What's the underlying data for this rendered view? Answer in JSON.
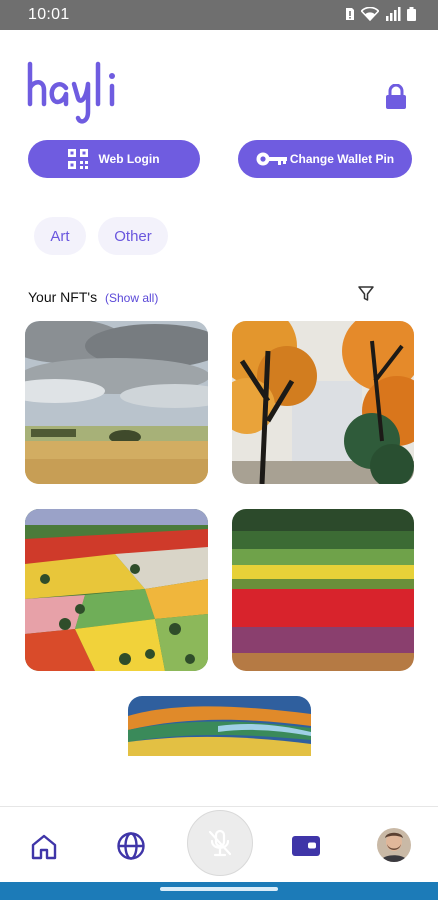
{
  "status_bar": {
    "time": "10:01"
  },
  "app": {
    "logo_text": "hayli",
    "brand_color": "#6f5ce0"
  },
  "actions": {
    "web_login_label": "Web Login",
    "change_pin_label": "Change Wallet Pin"
  },
  "categories": [
    "Art",
    "Other"
  ],
  "nfts_section": {
    "title": "Your NFT's",
    "show_all": "(Show all)"
  },
  "nfts": [
    {
      "name": "nft-clouds-field"
    },
    {
      "name": "nft-autumn-trees"
    },
    {
      "name": "nft-patchwork-fields"
    },
    {
      "name": "nft-tulip-stripes"
    },
    {
      "name": "nft-rolling-hills"
    }
  ],
  "bottom_nav": {
    "items": [
      "home-icon",
      "globe-icon",
      "mic-off-icon",
      "wallet-icon",
      "avatar"
    ]
  }
}
